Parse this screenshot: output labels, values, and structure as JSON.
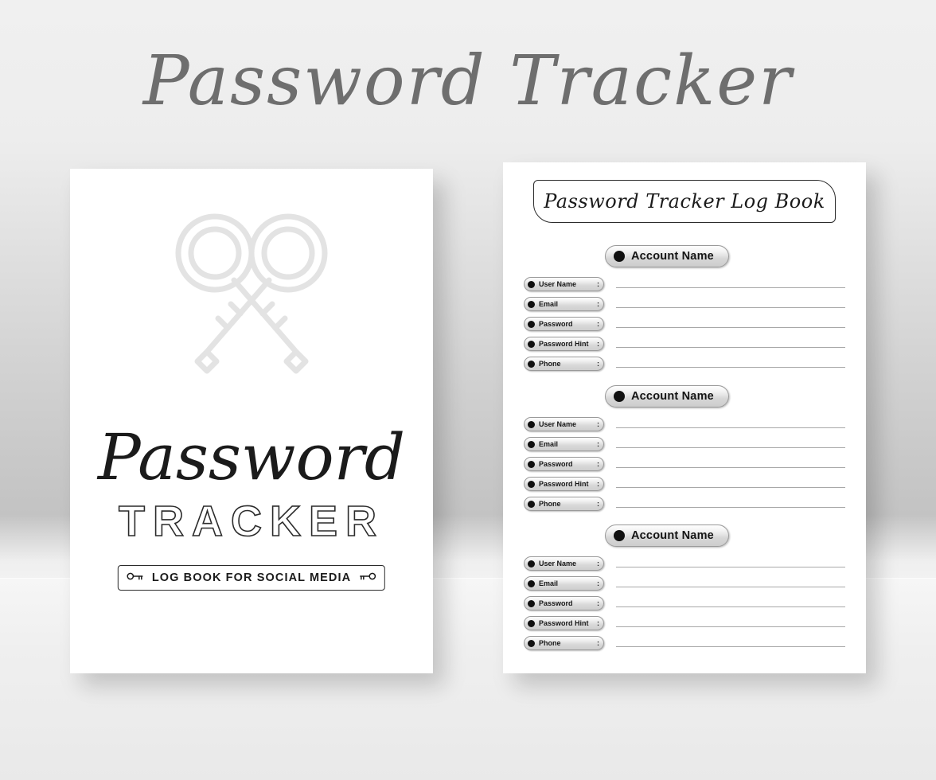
{
  "poster": {
    "main_title": "Password Tracker"
  },
  "cover": {
    "art_icon": "crossed-keys-icon",
    "script_title": "Password",
    "outline_title": "TRACKER",
    "subtitle": "LOG BOOK FOR SOCIAL MEDIA",
    "subtitle_left_icon": "key-icon",
    "subtitle_right_icon": "key-icon"
  },
  "log_page": {
    "banner_title": "Password Tracker Log Book",
    "account_label": "Account Name",
    "fields": [
      "User Name",
      "Email",
      "Password",
      "Password Hint",
      "Phone"
    ],
    "colon": ":",
    "blocks": [
      {
        "account_label": "Account Name"
      },
      {
        "account_label": "Account Name"
      },
      {
        "account_label": "Account Name"
      }
    ]
  },
  "colors": {
    "title_gray": "#6e6e6e",
    "ink": "#1b1b1b",
    "line": "#a8a8a8",
    "pill_border": "#9a9a9a"
  }
}
